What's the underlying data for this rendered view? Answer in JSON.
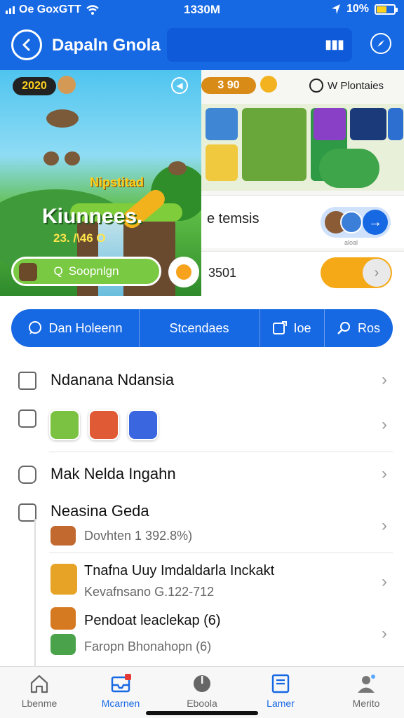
{
  "status_bar": {
    "carrier": "Oe GoxGTT",
    "time": "1330M",
    "battery": "10%"
  },
  "app_bar": {
    "title": "Dapaln Gnola",
    "search_icon": "grid-icon",
    "right_icon": "compass-icon"
  },
  "hero": {
    "coins": "2020",
    "logo_text": "Nipstitad",
    "title": "Kiunnees.",
    "subtitle": "23. /\\46 O",
    "search_label": "Soopnlgn"
  },
  "right_panel": {
    "coins": "3 90",
    "header": "W Plontaies",
    "row1_label": "e temsis",
    "row1_caption": "aloal",
    "row2_label": "3501"
  },
  "segments": [
    {
      "label": "Dan Holeenn",
      "icon": "chat-icon"
    },
    {
      "label": "Stcendaes",
      "icon": ""
    },
    {
      "label": "Ioe",
      "icon": "edit-icon"
    },
    {
      "label": "Ros",
      "icon": "search-icon"
    }
  ],
  "list": {
    "row1_title": "Ndanana Ndansia",
    "row3_title": "Mak Nelda Ingahn",
    "row4_title": "Neasina Geda",
    "row4_sub": "Dovhten 1 392.8%)",
    "row5_title": "Tnafna Uuy Imdaldarla Inckakt",
    "row5_sub": "Kevafnsano G.122-712",
    "row6_title": "Pendoat leaclekap (6)",
    "row6_sub": "Faropn Bhonahopn (6)"
  },
  "bottom_nav": [
    {
      "label": "Lbenme",
      "icon": "home-icon",
      "active": false
    },
    {
      "label": "Mcarnen",
      "icon": "inbox-icon",
      "active": true,
      "badge": "1"
    },
    {
      "label": "Eboola",
      "icon": "clock-icon",
      "active": false
    },
    {
      "label": "Lamer",
      "icon": "document-icon",
      "active": false
    },
    {
      "label": "Merito",
      "icon": "profile-icon",
      "active": false
    }
  ],
  "colors": {
    "primary": "#1668e3",
    "accent_orange": "#f5a917",
    "accent_green": "#7ac943"
  }
}
